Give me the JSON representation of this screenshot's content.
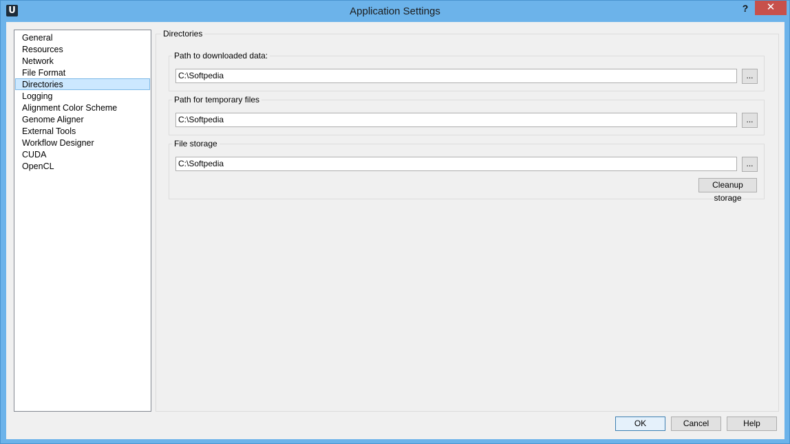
{
  "window": {
    "title": "Application Settings",
    "app_icon_letter": "U",
    "help_glyph": "?",
    "close_glyph": "✕"
  },
  "nav": {
    "items": [
      {
        "label": "General"
      },
      {
        "label": "Resources"
      },
      {
        "label": "Network"
      },
      {
        "label": "File Format"
      },
      {
        "label": "Directories",
        "selected": true
      },
      {
        "label": "Logging"
      },
      {
        "label": "Alignment Color Scheme"
      },
      {
        "label": "Genome Aligner"
      },
      {
        "label": "External Tools"
      },
      {
        "label": "Workflow Designer"
      },
      {
        "label": "CUDA"
      },
      {
        "label": "OpenCL"
      }
    ]
  },
  "directories": {
    "title": "Directories",
    "downloaded": {
      "label": "Path to downloaded data:",
      "value": "C:\\Softpedia",
      "browse": "..."
    },
    "temporary": {
      "label": "Path for temporary files",
      "value": "C:\\Softpedia",
      "browse": "..."
    },
    "storage": {
      "label": "File storage",
      "value": "C:\\Softpedia",
      "browse": "...",
      "cleanup": "Cleanup storage"
    }
  },
  "footer": {
    "ok": "OK",
    "cancel": "Cancel",
    "help": "Help"
  }
}
